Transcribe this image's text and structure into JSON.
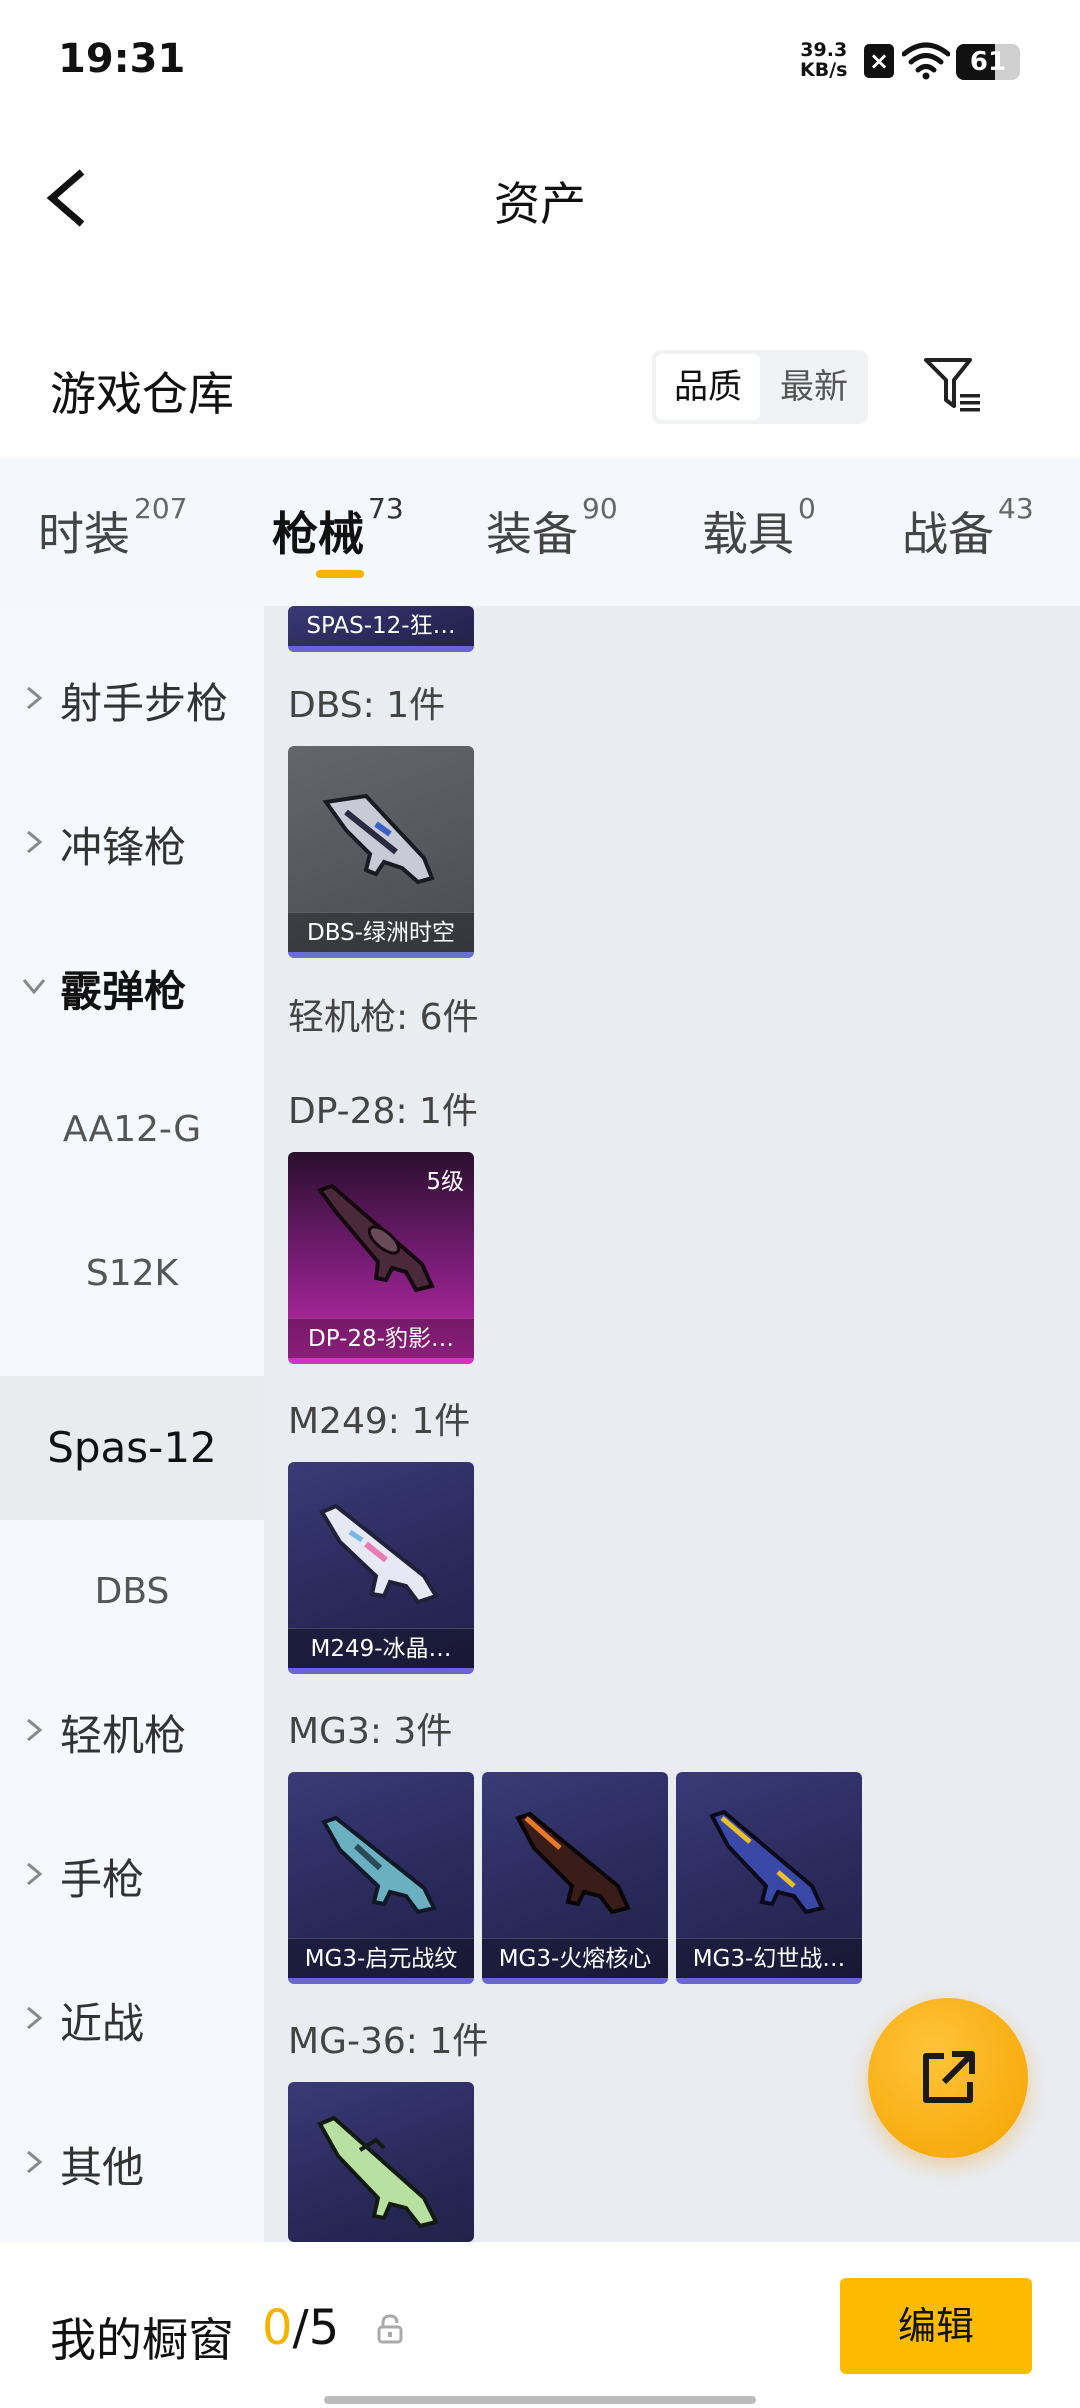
{
  "status_bar": {
    "time": "19:31",
    "net_speed_value": "39.3",
    "net_speed_unit": "KB/s",
    "battery": "61",
    "battery_level": 0.61
  },
  "header": {
    "title": "资产",
    "back_icon": "chevron-left-icon"
  },
  "section": {
    "title": "游戏仓库",
    "sort_options": [
      "品质",
      "最新"
    ],
    "selected_sort": "品质",
    "filter_icon": "filter-list-icon"
  },
  "tabs": [
    {
      "label": "时装",
      "count": "207",
      "active": false
    },
    {
      "label": "枪械",
      "count": "73",
      "active": true
    },
    {
      "label": "装备",
      "count": "90",
      "active": false
    },
    {
      "label": "载具",
      "count": "0",
      "active": false
    },
    {
      "label": "战备",
      "count": "43",
      "active": false
    }
  ],
  "sidebar": {
    "items": [
      {
        "label": "射手步枪",
        "type": "group",
        "expanded": false
      },
      {
        "label": "冲锋枪",
        "type": "group",
        "expanded": false
      },
      {
        "label": "霰弹枪",
        "type": "group",
        "expanded": true
      },
      {
        "label": "AA12-G",
        "type": "sub"
      },
      {
        "label": "S12K",
        "type": "sub"
      },
      {
        "label": "Spas-12",
        "type": "sub",
        "active": true
      },
      {
        "label": "DBS",
        "type": "sub"
      },
      {
        "label": "轻机枪",
        "type": "group",
        "expanded": false
      },
      {
        "label": "手枪",
        "type": "group",
        "expanded": false
      },
      {
        "label": "近战",
        "type": "group",
        "expanded": false
      },
      {
        "label": "其他",
        "type": "group",
        "expanded": false
      }
    ]
  },
  "content": {
    "partial_card": {
      "name": "SPAS-12-狂…"
    },
    "groups": [
      {
        "label": "DBS: 1件",
        "cards": [
          {
            "name": "DBS-绿洲时空",
            "style": "gray"
          }
        ]
      },
      {
        "label": "轻机枪: 6件",
        "cards": []
      },
      {
        "label": "DP-28: 1件",
        "cards": [
          {
            "name": "DP-28-豹影…",
            "style": "purple",
            "level": "5级"
          }
        ]
      },
      {
        "label": "M249: 1件",
        "cards": [
          {
            "name": "M249-冰晶…",
            "style": "blue"
          }
        ]
      },
      {
        "label": "MG3: 3件",
        "cards": [
          {
            "name": "MG3-启元战纹",
            "style": "blue"
          },
          {
            "name": "MG3-火熔核心",
            "style": "blue"
          },
          {
            "name": "MG3-幻世战…",
            "style": "blue"
          }
        ]
      },
      {
        "label": "MG-36: 1件",
        "cards": [
          {
            "name": "",
            "style": "blue"
          }
        ]
      }
    ]
  },
  "fab": {
    "icon": "share-external-icon"
  },
  "bottom_bar": {
    "title": "我的橱窗",
    "used": "0",
    "total": "/5",
    "lock_icon": "lock-icon",
    "edit_label": "编辑"
  },
  "colors": {
    "accent": "#f5b400",
    "edit_button": "#fdbb00",
    "card_blue": "#2a2a5c",
    "card_purple": "#c02aa8",
    "card_gray": "#4a4c54"
  }
}
